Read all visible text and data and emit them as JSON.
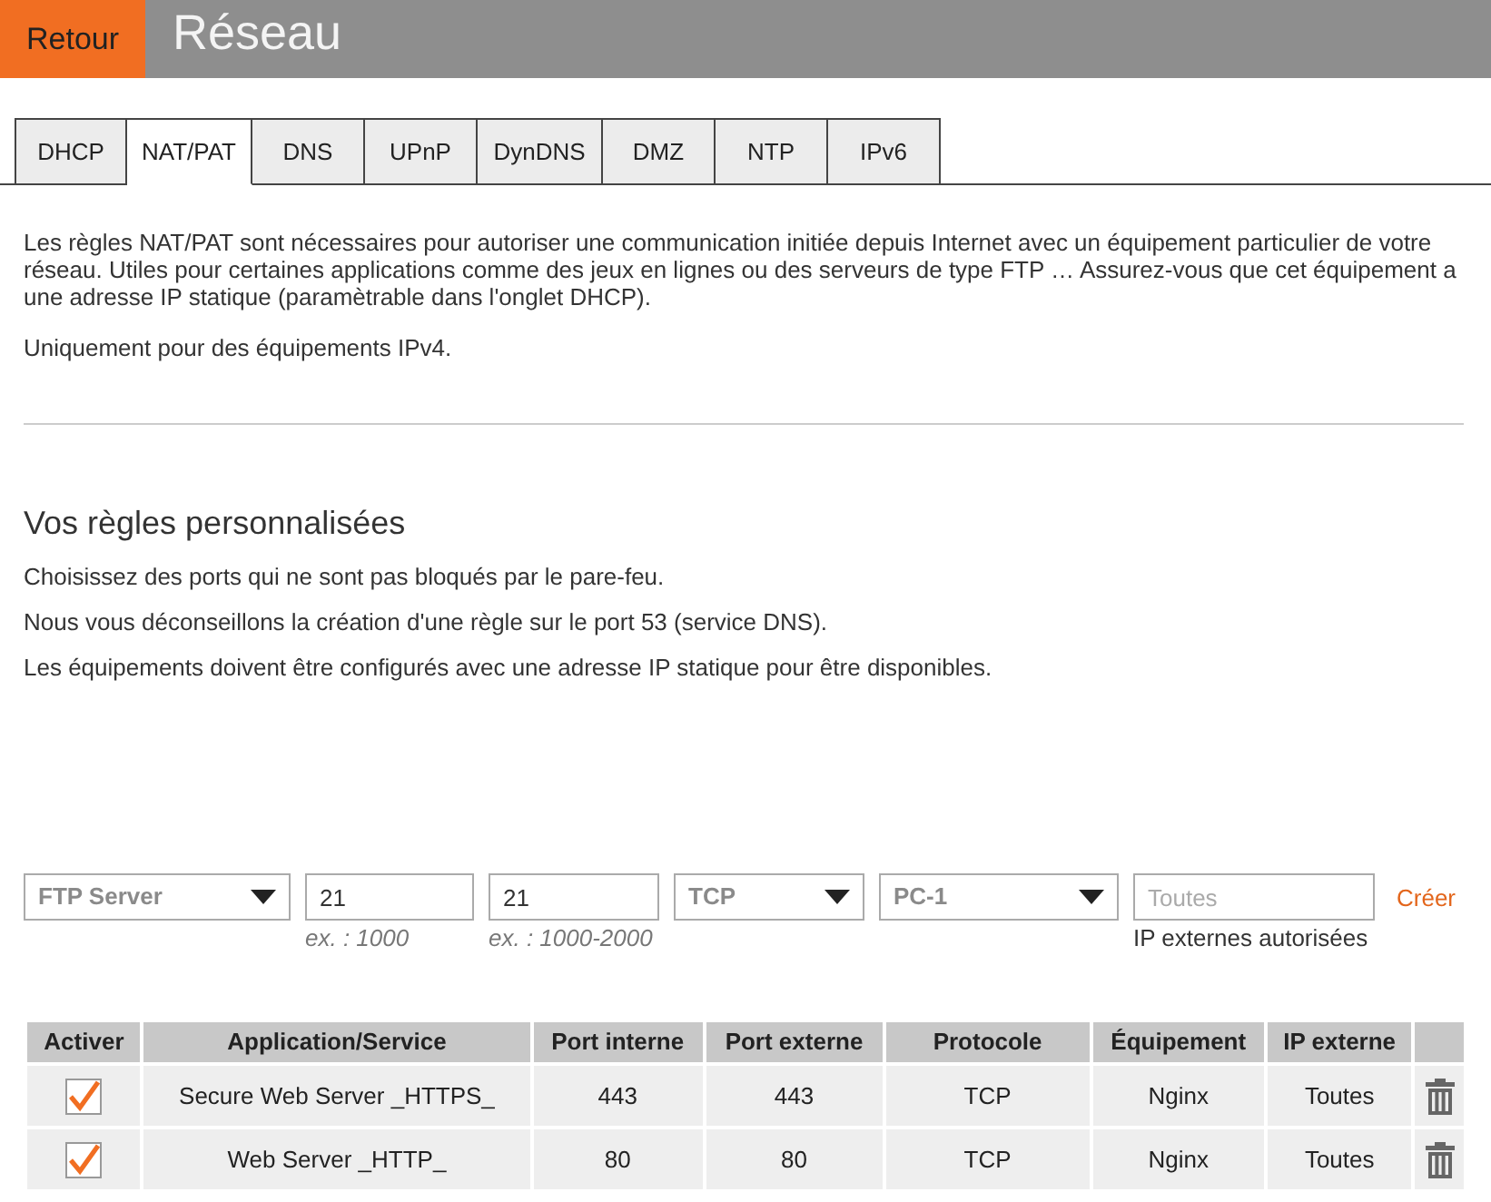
{
  "header": {
    "back_button": "Retour",
    "title": "Réseau"
  },
  "tabs": [
    {
      "label": "DHCP",
      "selected": false
    },
    {
      "label": "NAT/PAT",
      "selected": true
    },
    {
      "label": "DNS",
      "selected": false
    },
    {
      "label": "UPnP",
      "selected": false
    },
    {
      "label": "DynDNS",
      "selected": false
    },
    {
      "label": "DMZ",
      "selected": false
    },
    {
      "label": "NTP",
      "selected": false
    },
    {
      "label": "IPv6",
      "selected": false
    }
  ],
  "intro": {
    "paragraphs": [
      "Les règles NAT/PAT sont nécessaires pour autoriser une communication initiée depuis Internet avec un équipement particulier de votre réseau. Utiles pour certaines applications comme des jeux en lignes ou des serveurs de type FTP … Assurez-vous que cet équipement a une adresse IP statique (paramètrable dans l'onglet DHCP).",
      "Uniquement pour des équipements IPv4."
    ]
  },
  "custom_rules": {
    "title": "Vos règles personnalisées",
    "notes": [
      "Choisissez des ports qui ne sont pas bloqués par le pare-feu.",
      "Nous vous déconseillons la création d'une règle sur le port 53 (service DNS).",
      "Les équipements doivent être configurés avec une adresse IP statique pour être disponibles."
    ]
  },
  "rule_form": {
    "fields": [
      {
        "kind": "select",
        "value": "FTP Server"
      },
      {
        "kind": "input",
        "value": "21",
        "hint": "ex. : 1000"
      },
      {
        "kind": "input",
        "value": "21",
        "hint": "ex. : 1000-2000"
      },
      {
        "kind": "select",
        "value": "TCP"
      },
      {
        "kind": "select",
        "value": "PC-1"
      },
      {
        "kind": "input",
        "placeholder": "Toutes",
        "label": "IP externes autorisées"
      }
    ],
    "create_link": "Créer"
  },
  "table": {
    "columns": [
      "Activer",
      "Application/Service",
      "Port interne",
      "Port externe",
      "Protocole",
      "Équipement",
      "IP externe"
    ],
    "rows": [
      {
        "cells": [
          {
            "kind": "checkbox",
            "checked": true
          },
          {
            "kind": "text",
            "text": "Secure Web Server _HTTPS_"
          },
          {
            "kind": "text",
            "text": "443"
          },
          {
            "kind": "text",
            "text": "443"
          },
          {
            "kind": "text",
            "text": "TCP"
          },
          {
            "kind": "text",
            "text": "Nginx"
          },
          {
            "kind": "text",
            "text": "Toutes"
          }
        ]
      },
      {
        "cells": [
          {
            "kind": "checkbox",
            "checked": true
          },
          {
            "kind": "text",
            "text": "Web Server _HTTP_"
          },
          {
            "kind": "text",
            "text": "80"
          },
          {
            "kind": "text",
            "text": "80"
          },
          {
            "kind": "text",
            "text": "TCP"
          },
          {
            "kind": "text",
            "text": "Nginx"
          },
          {
            "kind": "text",
            "text": "Toutes"
          }
        ]
      }
    ]
  }
}
